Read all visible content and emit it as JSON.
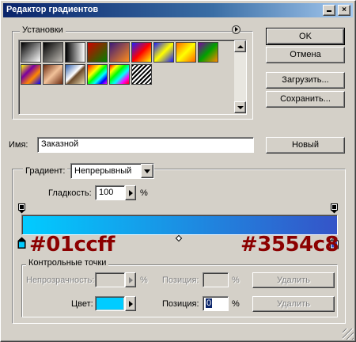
{
  "window": {
    "title": "Редактор градиентов"
  },
  "presets": {
    "label": "Установки",
    "swatches": [
      {
        "name": "preset-fg-bg",
        "bg": "linear-gradient(135deg,#000 0%,#fff 100%)"
      },
      {
        "name": "preset-fg-transparent",
        "bg": "linear-gradient(135deg,#000 0%,rgba(0,0,0,0.1) 100%)"
      },
      {
        "name": "preset-black-white",
        "bg": "linear-gradient(90deg,#000 0%,#fff 100%)"
      },
      {
        "name": "preset-red-green",
        "bg": "linear-gradient(135deg,#d00000 0%,#008000 100%)"
      },
      {
        "name": "preset-violet-orange",
        "bg": "linear-gradient(135deg,#3b1a7a 0%,#ff8c1a 100%)"
      },
      {
        "name": "preset-blue-red-yellow",
        "bg": "linear-gradient(135deg,#1f1fff 0%,#ff0000 50%,#ffff00 100%)"
      },
      {
        "name": "preset-blue-yellow-blue",
        "bg": "linear-gradient(135deg,#1a1aff 0%,#ffff00 50%,#1a1aff 100%)"
      },
      {
        "name": "preset-orange-yellow-orange",
        "bg": "linear-gradient(135deg,#ff6600 0%,#ffff00 50%,#ff6600 100%)"
      },
      {
        "name": "preset-violet-green-orange",
        "bg": "linear-gradient(135deg,#7a00a0 0%,#00a000 50%,#ff8800 100%)"
      },
      {
        "name": "preset-yellow-violet-orange-blue",
        "bg": "linear-gradient(135deg,#ffff00 0%,#7a00a0 35%,#ff8800 65%,#0000ff 100%)"
      },
      {
        "name": "preset-copper",
        "bg": "linear-gradient(135deg,#6b2a10 0%,#f2c29a 50%,#6b2a10 100%)"
      },
      {
        "name": "preset-chrome",
        "bg": "linear-gradient(135deg,#2a5aa8 0%,#ffffff 45%,#6b4a2a 55%,#e8d8b0 100%)"
      },
      {
        "name": "preset-spectrum",
        "bg": "linear-gradient(135deg,#ff0000,#ff8800,#ffff00,#00ff00,#00ffff,#0000ff,#ff00ff)"
      },
      {
        "name": "preset-transparent-rainbow",
        "bg": "linear-gradient(135deg,#ff0000,#ffff00,#00ff00,#00ffff,#ff00ff,#ff0000)"
      },
      {
        "name": "preset-transparent-stripes",
        "bg": "repeating-linear-gradient(135deg,#000 0px,#000 2px,#fff 2px,#fff 4px)"
      }
    ]
  },
  "buttons": {
    "ok": "OK",
    "cancel": "Отмена",
    "load": "Загрузить...",
    "save": "Сохранить...",
    "new": "Новый"
  },
  "name": {
    "label": "Имя:",
    "value": "Заказной"
  },
  "gradient": {
    "type_label": "Градиент:",
    "type_value": "Непрерывный",
    "smoothness_label": "Гладкость:",
    "smoothness_value": "100",
    "smoothness_unit": "%",
    "start_color": "#01ccff",
    "end_color": "#3554c8",
    "start_color_text": "#01ccff",
    "end_color_text": "#3554c8"
  },
  "stops": {
    "group_label": "Контрольные точки",
    "opacity_label": "Непрозрачность:",
    "opacity_unit": "%",
    "opacity_position_label": "Позиция:",
    "opacity_position_unit": "%",
    "opacity_delete": "Удалить",
    "color_label": "Цвет:",
    "color_value": "#01ccff",
    "color_position_label": "Позиция:",
    "color_position_value": "0",
    "color_position_unit": "%",
    "color_delete": "Удалить"
  }
}
